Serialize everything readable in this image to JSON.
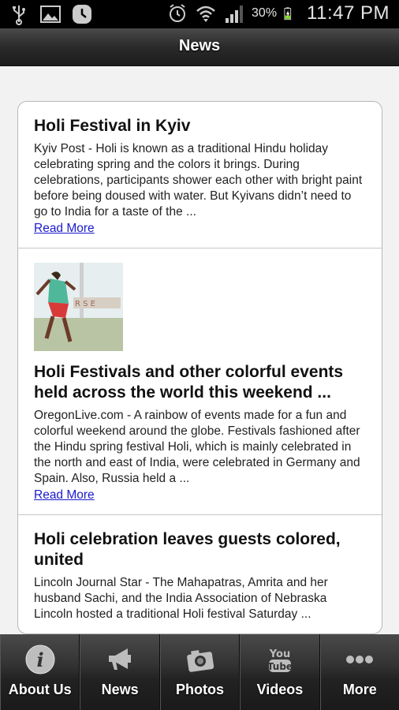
{
  "status_bar": {
    "battery_percent": "30%",
    "time": "11:47 PM"
  },
  "header": {
    "title": "News"
  },
  "news": {
    "items": [
      {
        "title": "Holi Festival in Kyiv",
        "summary": "Kyiv Post - Holi is known as a traditional Hindu holiday celebrating spring and the colors it brings. During celebrations, participants shower each other with bright paint before being doused with water. But Kyivans didn’t need to go to India for a taste of the ...",
        "link": "Read More"
      },
      {
        "title": "Holi Festivals and other colorful events held across the world this weekend ...",
        "summary": "OregonLive.com - A rainbow of events made for a fun and colorful weekend around the globe. Festivals fashioned after the Hindu spring festival Holi, which is mainly celebrated in the north and east of India, were celebrated in Germany and Spain. Also, Russia held a ...",
        "link": "Read More"
      },
      {
        "title": "Holi celebration leaves guests colored, united",
        "summary": "Lincoln Journal Star - The Mahapatras, Amrita and her husband Sachi, and the India Association of Nebraska Lincoln hosted a traditional Holi festival Saturday ..."
      }
    ]
  },
  "tabs": [
    {
      "label": "About Us",
      "icon": "info-icon"
    },
    {
      "label": "News",
      "icon": "megaphone-icon"
    },
    {
      "label": "Photos",
      "icon": "camera-icon"
    },
    {
      "label": "Videos",
      "icon": "youtube-icon"
    },
    {
      "label": "More",
      "icon": "more-dots-icon"
    }
  ]
}
